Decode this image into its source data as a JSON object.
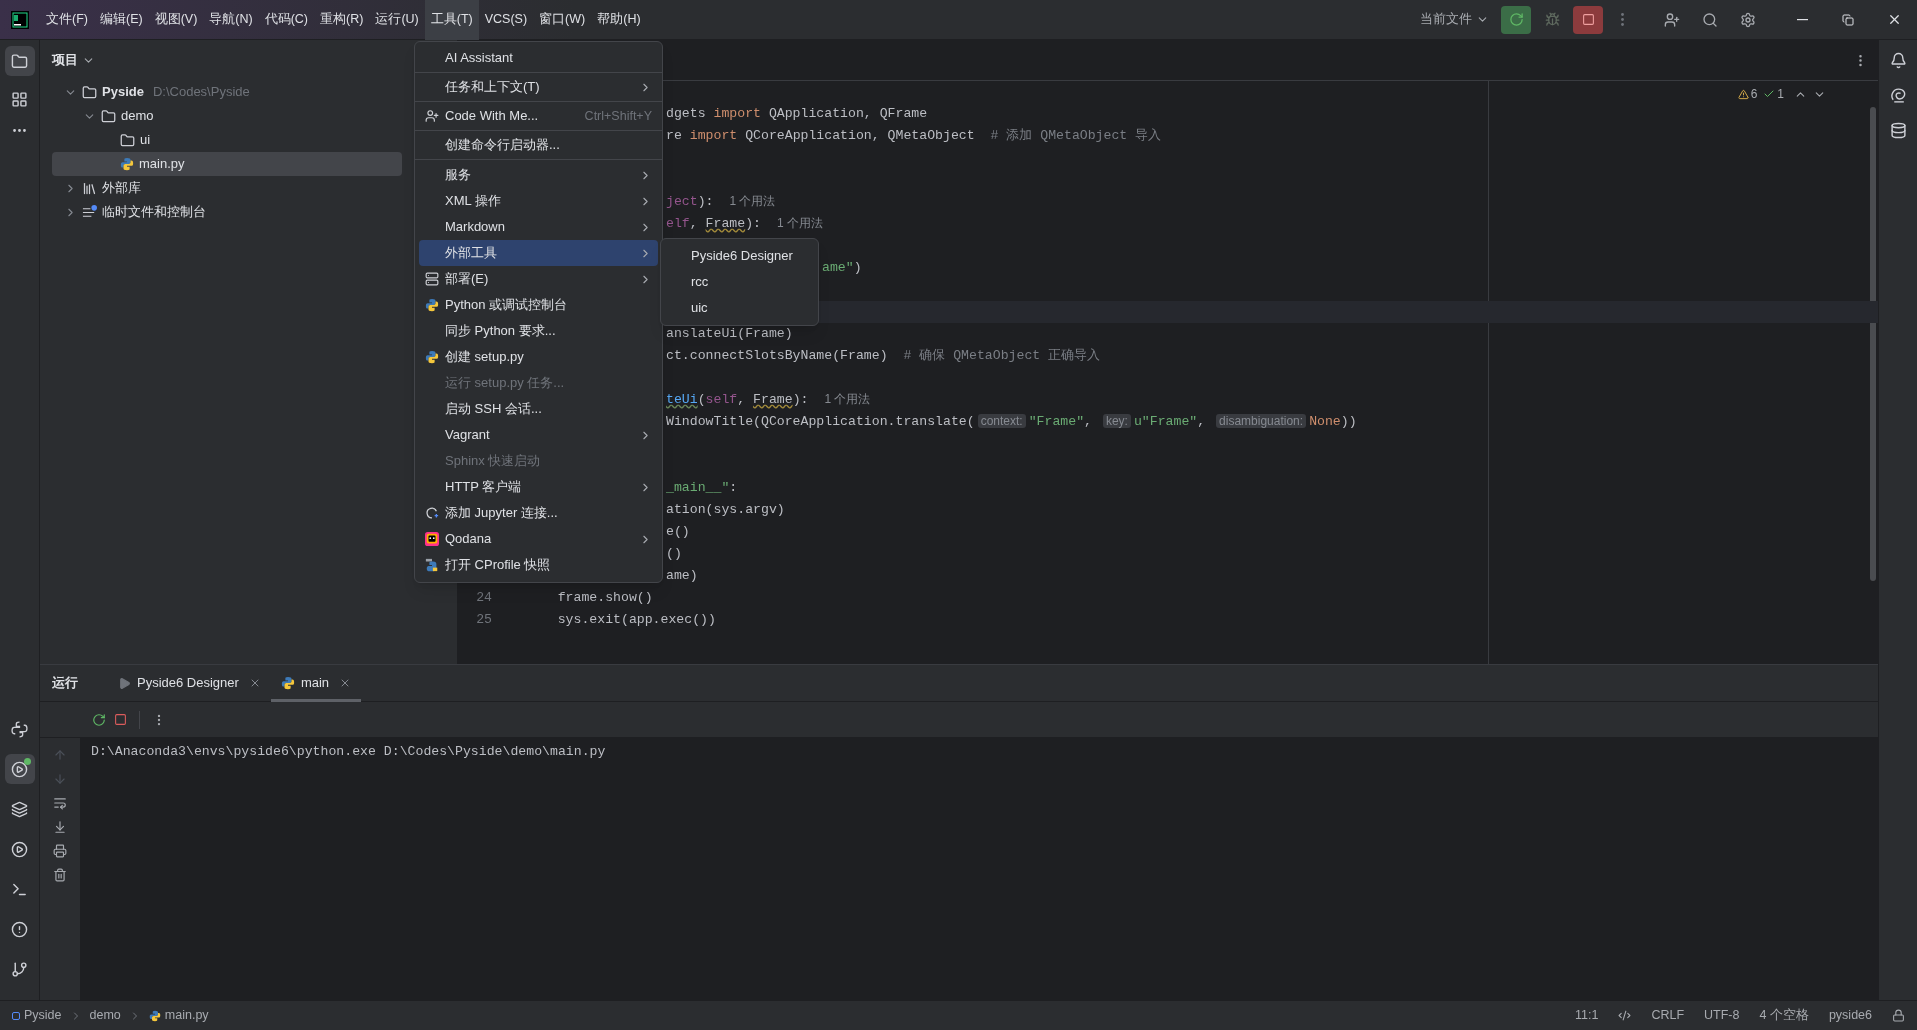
{
  "menu_bar": {
    "items": [
      {
        "label": "文件(F)",
        "selected": false
      },
      {
        "label": "编辑(E)",
        "selected": false
      },
      {
        "label": "视图(V)",
        "selected": false
      },
      {
        "label": "导航(N)",
        "selected": false
      },
      {
        "label": "代码(C)",
        "selected": false
      },
      {
        "label": "重构(R)",
        "selected": false
      },
      {
        "label": "运行(U)",
        "selected": false
      },
      {
        "label": "工具(T)",
        "selected": true
      },
      {
        "label": "VCS(S)",
        "selected": false
      },
      {
        "label": "窗口(W)",
        "selected": false
      },
      {
        "label": "帮助(H)",
        "selected": false
      }
    ]
  },
  "run_config": {
    "label": "当前文件"
  },
  "tool_strip": {
    "top": [
      {
        "selected": true
      },
      {
        "selected": false
      }
    ],
    "bottom": [
      {
        "selected": false
      },
      {
        "selected": true
      },
      {
        "selected": false
      },
      {
        "selected": false
      },
      {
        "selected": false
      },
      {
        "selected": false
      },
      {
        "selected": false
      }
    ]
  },
  "project": {
    "title": "项目",
    "tree": [
      {
        "label": "Pyside",
        "path": "D:\\Codes\\Pyside",
        "expanded": true,
        "selected": false,
        "children": [
          {
            "label": "demo",
            "expanded": true,
            "selected": false,
            "children": [
              {
                "label": "ui",
                "selected": false
              },
              {
                "label": "main.py",
                "selected": true
              }
            ]
          }
        ]
      },
      {
        "label": "外部库",
        "expanded": false,
        "selected": false
      },
      {
        "label": "临时文件和控制台",
        "expanded": false,
        "selected": false
      }
    ]
  },
  "editor": {
    "inspections": {
      "warnings": "6",
      "typos": "1"
    },
    "lines": [
      {
        "kind": "blank",
        "current": false
      },
      {
        "kind": "cut",
        "current": false,
        "tokens": [
          {
            "text": "dgets ",
            "kind": "plain"
          },
          {
            "text": "import",
            "kind": "keyword"
          },
          {
            "text": " QApplication, QFrame",
            "kind": "plain"
          }
        ]
      },
      {
        "kind": "cut",
        "current": false,
        "tokens": [
          {
            "text": "re ",
            "kind": "plain"
          },
          {
            "text": "import",
            "kind": "keyword"
          },
          {
            "text": " QCoreApplication, QMetaObject  ",
            "kind": "plain"
          },
          {
            "text": "# 添加 QMetaObject 导入",
            "kind": "comment"
          }
        ]
      },
      {
        "kind": "blank",
        "current": false
      },
      {
        "kind": "blank",
        "current": false
      },
      {
        "kind": "cut",
        "current": false,
        "tokens": [
          {
            "text": "ject",
            "kind": "self"
          },
          {
            "text": "):",
            "kind": "plain"
          },
          {
            "text": "1 个用法",
            "kind": "usage"
          }
        ]
      },
      {
        "kind": "cut",
        "current": false,
        "tokens": [
          {
            "text": "elf",
            "kind": "self"
          },
          {
            "text": ", ",
            "kind": "plain"
          },
          {
            "text": "Frame",
            "kind": "warn"
          },
          {
            "text": "):",
            "kind": "plain"
          },
          {
            "text": "1 个用法",
            "kind": "usage"
          }
        ]
      },
      {
        "kind": "blank",
        "current": false
      },
      {
        "kind": "cut_submenu",
        "current": false,
        "tokens": [
          {
            "text": "ame\"",
            "kind": "string"
          },
          {
            "text": ")",
            "kind": "plain"
          }
        ]
      },
      {
        "kind": "blank",
        "current": false
      },
      {
        "kind": "blank",
        "current": true
      },
      {
        "kind": "cut",
        "current": false,
        "tokens": [
          {
            "text": "anslateUi(Frame)",
            "kind": "plain"
          }
        ]
      },
      {
        "kind": "cut",
        "current": false,
        "tokens": [
          {
            "text": "ct.connectSlotsByName(Frame)  ",
            "kind": "plain"
          },
          {
            "text": "# 确保 QMetaObject 正确导入",
            "kind": "comment"
          }
        ]
      },
      {
        "kind": "blank",
        "current": false
      },
      {
        "kind": "cut",
        "current": false,
        "tokens": [
          {
            "text": "teUi",
            "kind": "fn"
          },
          {
            "text": "(",
            "kind": "plain"
          },
          {
            "text": "self",
            "kind": "self"
          },
          {
            "text": ", ",
            "kind": "plain"
          },
          {
            "text": "Frame",
            "kind": "warn"
          },
          {
            "text": "):",
            "kind": "plain"
          },
          {
            "text": "1 个用法",
            "kind": "usage"
          }
        ]
      },
      {
        "kind": "cut",
        "current": false,
        "tokens": [
          {
            "text": "WindowTitle(QCoreApplication.translate(",
            "kind": "plain"
          },
          {
            "text": "context:",
            "kind": "inlay"
          },
          {
            "text": "\"Frame\"",
            "kind": "string"
          },
          {
            "text": ", ",
            "kind": "plain"
          },
          {
            "text": "key:",
            "kind": "inlay"
          },
          {
            "text": "u\"Frame\"",
            "kind": "string"
          },
          {
            "text": ", ",
            "kind": "plain"
          },
          {
            "text": "disambiguation:",
            "kind": "inlay"
          },
          {
            "text": "None",
            "kind": "keyword"
          },
          {
            "text": "))",
            "kind": "plain"
          }
        ]
      },
      {
        "kind": "blank",
        "current": false
      },
      {
        "kind": "blank",
        "current": false
      },
      {
        "kind": "cut",
        "current": false,
        "tokens": [
          {
            "text": "_main__\"",
            "kind": "string"
          },
          {
            "text": ":",
            "kind": "plain"
          }
        ]
      },
      {
        "kind": "cut",
        "current": false,
        "tokens": [
          {
            "text": "ation(sys.argv)",
            "kind": "plain"
          }
        ]
      },
      {
        "kind": "cut",
        "current": false,
        "tokens": [
          {
            "text": "e()",
            "kind": "plain"
          }
        ]
      },
      {
        "kind": "cut",
        "current": false,
        "tokens": [
          {
            "text": "()",
            "kind": "plain"
          }
        ]
      },
      {
        "kind": "cut",
        "current": false,
        "tokens": [
          {
            "text": "ame)",
            "kind": "plain"
          }
        ]
      },
      {
        "kind": "full",
        "current": false,
        "number": "24",
        "tokens": [
          {
            "text": "    frame.show()",
            "kind": "plain"
          }
        ]
      },
      {
        "kind": "full",
        "current": false,
        "number": "25",
        "tokens": [
          {
            "text": "    sys.exit(app.exec())",
            "kind": "plain"
          }
        ]
      }
    ]
  },
  "tools_menu": {
    "sections": [
      [
        {
          "label": "AI Assistant",
          "submenu": false,
          "disabled": false,
          "selected": false
        }
      ],
      [
        {
          "label": "任务和上下文(T)",
          "submenu": true,
          "disabled": false,
          "selected": false
        }
      ],
      [
        {
          "label": "Code With Me...",
          "shortcut": "Ctrl+Shift+Y",
          "submenu": false,
          "disabled": false,
          "selected": false
        }
      ],
      [
        {
          "label": "创建命令行启动器...",
          "submenu": false,
          "disabled": false,
          "selected": false
        }
      ],
      [
        {
          "label": "服务",
          "submenu": true,
          "disabled": false,
          "selected": false
        },
        {
          "label": "XML 操作",
          "submenu": true,
          "disabled": false,
          "selected": false
        },
        {
          "label": "Markdown",
          "submenu": true,
          "disabled": false,
          "selected": false
        },
        {
          "label": "外部工具",
          "submenu": true,
          "disabled": false,
          "selected": true
        },
        {
          "label": "部署(E)",
          "submenu": true,
          "disabled": false,
          "selected": false
        },
        {
          "label": "Python 或调试控制台",
          "submenu": false,
          "disabled": false,
          "selected": false
        },
        {
          "label": "同步 Python 要求...",
          "submenu": false,
          "disabled": false,
          "selected": false
        },
        {
          "label": "创建 setup.py",
          "submenu": false,
          "disabled": false,
          "selected": false
        },
        {
          "label": "运行 setup.py 任务...",
          "submenu": false,
          "disabled": true,
          "selected": false
        },
        {
          "label": "启动 SSH 会话...",
          "submenu": false,
          "disabled": false,
          "selected": false
        },
        {
          "label": "Vagrant",
          "submenu": true,
          "disabled": false,
          "selected": false
        },
        {
          "label": "Sphinx 快速启动",
          "submenu": false,
          "disabled": true,
          "selected": false
        },
        {
          "label": "HTTP 客户端",
          "submenu": true,
          "disabled": false,
          "selected": false
        },
        {
          "label": "添加 Jupyter 连接...",
          "submenu": false,
          "disabled": false,
          "selected": false
        },
        {
          "label": "Qodana",
          "submenu": true,
          "disabled": false,
          "selected": false
        },
        {
          "label": "打开 CProfile 快照",
          "submenu": false,
          "disabled": false,
          "selected": false
        }
      ]
    ]
  },
  "external_tools_menu": {
    "items": [
      {
        "label": "Pyside6 Designer"
      },
      {
        "label": "rcc"
      },
      {
        "label": "uic"
      }
    ]
  },
  "run_panel": {
    "title": "运行",
    "tabs": [
      {
        "label": "Pyside6 Designer",
        "selected": false
      },
      {
        "label": "main",
        "selected": true
      }
    ],
    "output": "D:\\Anaconda3\\envs\\pyside6\\python.exe D:\\Codes\\Pyside\\demo\\main.py"
  },
  "status_bar": {
    "breadcrumbs": [
      "Pyside",
      "demo",
      "main.py"
    ],
    "position": "11:1",
    "line_separator": "CRLF",
    "encoding": "UTF-8",
    "indent": "4 个空格",
    "interpreter": "pyside6"
  }
}
